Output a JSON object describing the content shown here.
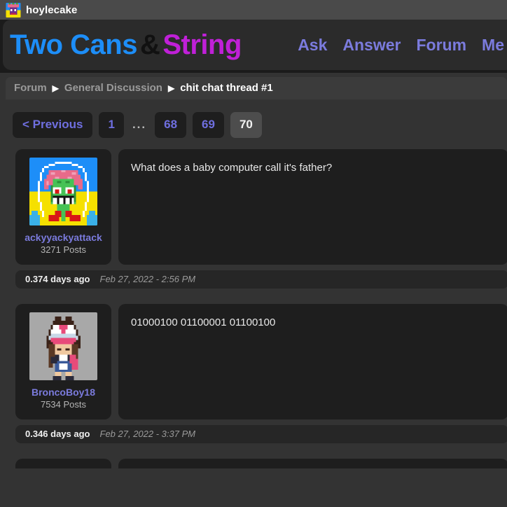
{
  "topbar": {
    "username": "hoylecake",
    "avatar_icon": "pixel-avatar-icon"
  },
  "header": {
    "logo_part1": "Two Cans",
    "logo_amp": "&",
    "logo_part2": "String",
    "nav": [
      {
        "label": "Ask"
      },
      {
        "label": "Answer"
      },
      {
        "label": "Forum"
      },
      {
        "label": "Me"
      }
    ]
  },
  "breadcrumb": {
    "items": [
      {
        "label": "Forum",
        "current": false
      },
      {
        "label": "General Discussion",
        "current": false
      },
      {
        "label": "chit chat thread #1",
        "current": true
      }
    ],
    "separator": "▶"
  },
  "pagination": {
    "previous_label": "< Previous",
    "ellipsis": "...",
    "pages": [
      "1",
      "68",
      "69",
      "70"
    ],
    "active_page": "70"
  },
  "posts": [
    {
      "username": "ackyyackyattack",
      "postcount": "3271 Posts",
      "avatar_name": "avatar-zombie-clown",
      "content": "What does a baby computer call it's father?",
      "relative_time": "0.374 days ago",
      "absolute_time": "Feb 27, 2022 - 2:56 PM"
    },
    {
      "username": "BroncoBoy18",
      "postcount": "7534 Posts",
      "avatar_name": "avatar-trainer-sprite",
      "content": "01000100 01100001 01100100",
      "relative_time": "0.346 days ago",
      "absolute_time": "Feb 27, 2022 - 3:37 PM"
    }
  ],
  "colors": {
    "page_background": "#333333",
    "card_background": "#1e1e1e",
    "link_blue": "#7b7bdd",
    "logo_blue": "#1d8ef8",
    "logo_magenta": "#c020d8",
    "active_page_background": "#4d4d4d"
  }
}
